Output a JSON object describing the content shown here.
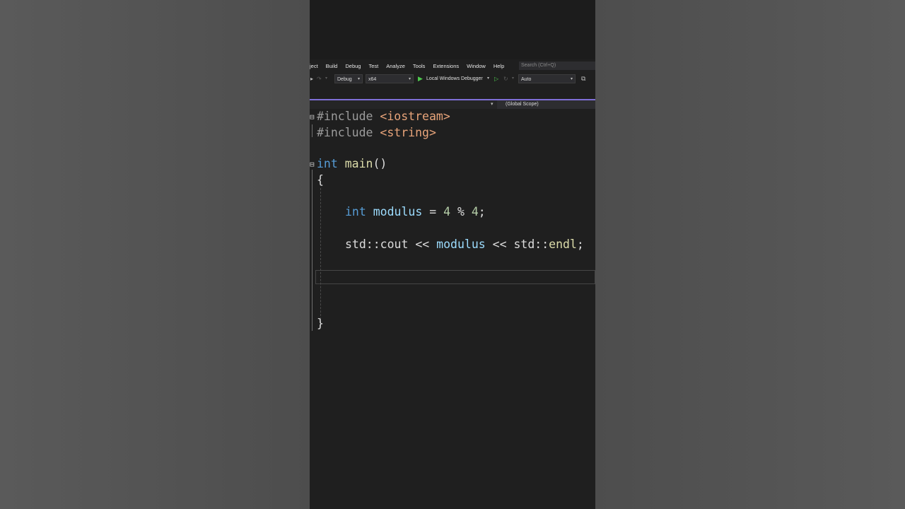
{
  "menu": {
    "items": [
      "ject",
      "Build",
      "Debug",
      "Test",
      "Analyze",
      "Tools",
      "Extensions",
      "Window",
      "Help"
    ],
    "search_placeholder": "Search (Ctrl+Q)"
  },
  "toolbar": {
    "config": "Debug",
    "platform": "x64",
    "run_label": "Local Windows Debugger",
    "auto": "Auto"
  },
  "navbar": {
    "scope": "(Global Scope)"
  },
  "code": {
    "include1": {
      "directive": "#include",
      "header": "<iostream>"
    },
    "include2": {
      "directive": "#include",
      "header": "<string>"
    },
    "main_kw": "int",
    "main_fn": "main",
    "main_parens": "()",
    "open_brace": "{",
    "decl_kw": "int",
    "decl_var": "modulus",
    "decl_eq": " = ",
    "decl_a": "4",
    "decl_op": " % ",
    "decl_b": "4",
    "decl_semi": ";",
    "cout_ns1": "std::",
    "cout_name": "cout",
    "cout_op1": " << ",
    "cout_var": "modulus",
    "cout_op2": " << ",
    "cout_ns2": "std::",
    "cout_endl": "endl",
    "cout_semi": ";",
    "close_brace": "}"
  }
}
